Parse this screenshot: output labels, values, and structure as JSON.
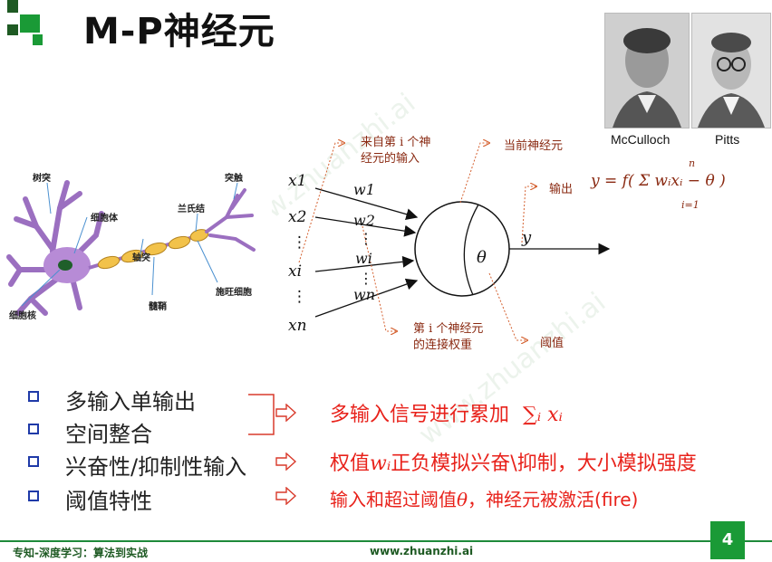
{
  "title": "M-P神经元",
  "colors": {
    "accent_green": "#1a9a36",
    "dark_green": "#1e5a23",
    "red": "#e8221b",
    "bullet_blue": "#1f3aa8"
  },
  "photos": [
    {
      "caption": "McCulloch"
    },
    {
      "caption": "Pitts"
    }
  ],
  "neuron_labels": {
    "dendrite": "树突",
    "cell_body": "细胞体",
    "nucleus": "细胞核",
    "axon": "轴突",
    "node_ranvier": "兰氏结",
    "synapse": "突触",
    "myelin": "髓鞘",
    "schwann": "施旺细胞"
  },
  "model": {
    "inputs": [
      "x1",
      "x2",
      "⋮",
      "xi",
      "⋮",
      "xn"
    ],
    "weights": [
      "w1",
      "w2",
      "⋮",
      "wi",
      "⋮",
      "wn"
    ],
    "theta": "θ",
    "output": "y",
    "annot_input": [
      "来自第 i 个神",
      "经元的输入"
    ],
    "annot_current": "当前神经元",
    "annot_output": "输出",
    "annot_weight": [
      "第 i 个神经元",
      "的连接权重"
    ],
    "annot_threshold": "阈值",
    "formula": "y = f( Σ wᵢxᵢ − θ )",
    "sum_upper": "n",
    "sum_lower": "i=1"
  },
  "bullets": [
    "多输入单输出",
    "空间整合",
    "兴奋性/抑制性输入",
    "阈值特性"
  ],
  "explanations": {
    "line1_text": "多输入信号进行累加",
    "line1_math": "∑ᵢ xᵢ",
    "line2_a": "权值",
    "line2_math": "wᵢ",
    "line2_b": "正负模拟兴奋\\抑制，大小模拟强度",
    "line3_a": "输入和超过阈值",
    "line3_math": "θ",
    "line3_b": "，神经元被激活(fire)"
  },
  "footer": {
    "left": "专知-深度学习：算法到实战",
    "url": "www.zhuanzhi.ai",
    "page": "4"
  },
  "watermark": "www.zhuanzhi.ai"
}
